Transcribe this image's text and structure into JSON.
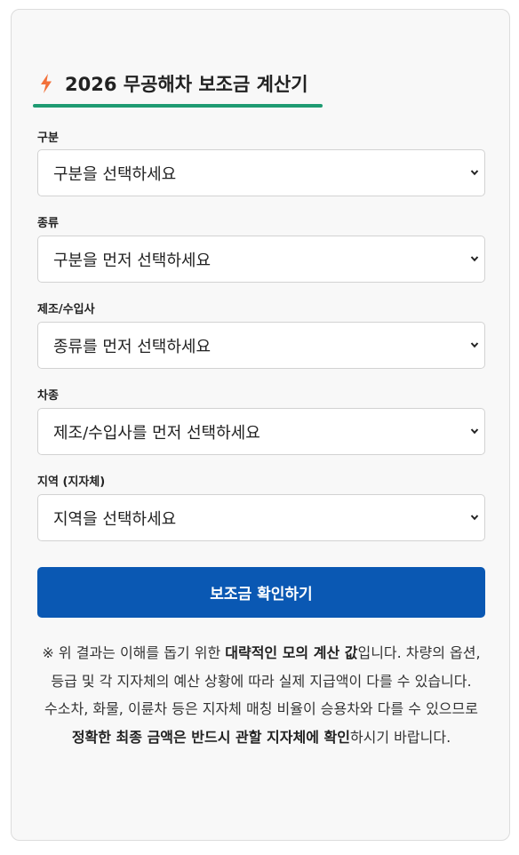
{
  "title": "2026 무공해차 보조금 계산기",
  "accent_color": "#1e9b72",
  "icon_bolt_color": "#f2713a",
  "button_color": "#0a58b3",
  "fields": [
    {
      "label": "구분",
      "value": "구분을 선택하세요"
    },
    {
      "label": "종류",
      "value": "구분을 먼저 선택하세요"
    },
    {
      "label": "제조/수입사",
      "value": "종류를 먼저 선택하세요"
    },
    {
      "label": "차종",
      "value": "제조/수입사를 먼저 선택하세요"
    },
    {
      "label": "지역 (지자체)",
      "value": "지역을 선택하세요"
    }
  ],
  "button_label": "보조금 확인하기",
  "notes": {
    "p1_a": "※ 위 결과는 이해를 돕기 위한 ",
    "p1_b": "대략적인 모의 계산 값",
    "p1_c": "입니다. 차량의 옵션, 등급 및 각 지자체의 예산 상황에 따라 실제 지급액이 다를 수 있습니다.",
    "p2_a": "수소차, 화물, 이륜차 등은 지자체 매칭 비율이 승용차와 다를 수 있으므로 ",
    "p2_b": "정확한 최종 금액은 반드시 관할 지자체에 확인",
    "p2_c": "하시기 바랍니다."
  }
}
